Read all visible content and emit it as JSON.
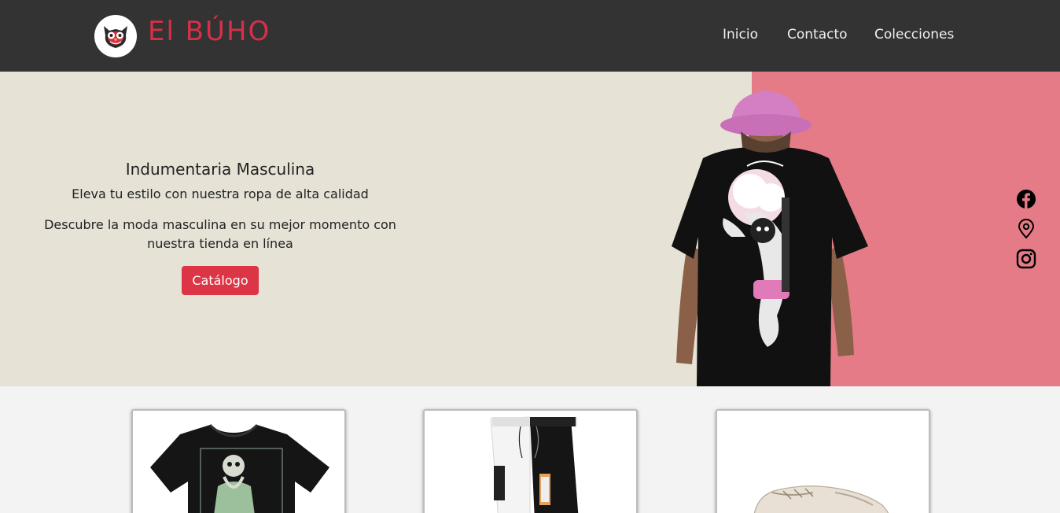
{
  "navbar": {
    "brand": "El BÚHO",
    "links": {
      "inicio": "Inicio",
      "contacto": "Contacto",
      "colecciones": "Colecciones"
    }
  },
  "hero": {
    "title": "Indumentaria Masculina",
    "subtitle": "Eleva tu estilo con nuestra ropa de alta calidad",
    "description": "Descubre la moda masculina en su mejor momento con nuestra tienda en línea",
    "cta_label": "Catálogo"
  },
  "social": [
    "facebook-icon",
    "location-pin-icon",
    "instagram-icon"
  ],
  "products": [
    {
      "image": "black-graphic-tshirt"
    },
    {
      "image": "black-white-joggers"
    },
    {
      "image": "white-sneakers"
    }
  ],
  "colors": {
    "navbar_bg": "#333333",
    "brand": "#d63048",
    "hero_bg": "#e6e2d6",
    "hero_accent": "#e47b86",
    "cta": "#dc3545",
    "page_bg": "#f3f3f3"
  }
}
